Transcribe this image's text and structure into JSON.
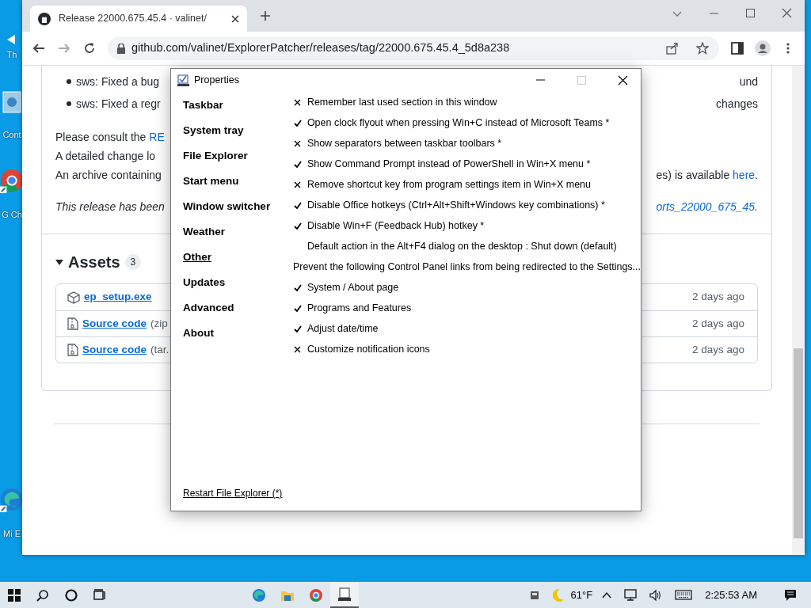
{
  "desktop": {
    "icons": [
      {
        "kind": "arrow",
        "label": "Th"
      },
      {
        "kind": "panel",
        "label": "Cont"
      },
      {
        "kind": "chrome",
        "label": "G Ch"
      },
      {
        "kind": "edge",
        "label": "Mi E"
      }
    ]
  },
  "browser": {
    "tab": {
      "title": "Release 22000.675.45.4 · valinet/"
    },
    "address": "github.com/valinet/ExplorerPatcher/releases/tag/22000.675.45.4_5d8a238",
    "page": {
      "bullets": [
        {
          "left": "sws: Fixed a bug",
          "right": "und"
        },
        {
          "left": "sws: Fixed a regr",
          "right": "changes"
        }
      ],
      "lines": [
        {
          "italic": false,
          "left": [
            {
              "kind": "text",
              "text": "Please consult the "
            },
            {
              "kind": "link",
              "text": "RE"
            }
          ]
        },
        {
          "italic": false,
          "left": [
            {
              "kind": "text",
              "text": "A detailed change lo"
            }
          ]
        },
        {
          "italic": false,
          "left": [
            {
              "kind": "text",
              "text": "An archive containing"
            }
          ],
          "right": [
            {
              "kind": "text",
              "text": "es) is available "
            },
            {
              "kind": "link",
              "text": "here"
            },
            {
              "kind": "text",
              "text": "."
            }
          ]
        },
        {
          "italic": true,
          "left": [
            {
              "kind": "text",
              "text": "This release has been"
            }
          ],
          "right": [
            {
              "kind": "link",
              "text": "orts_22000_675_45"
            },
            {
              "kind": "text",
              "text": "."
            }
          ]
        }
      ],
      "assets": {
        "title": "Assets",
        "count": "3",
        "files": [
          {
            "kind": "package",
            "name": "ep_setup.exe",
            "age": "2 days ago"
          },
          {
            "kind": "archive",
            "name": "Source code",
            "ext": "(zip",
            "age": "2 days ago"
          },
          {
            "kind": "archive",
            "name": "Source code",
            "ext": "(tar.",
            "age": "2 days ago"
          }
        ]
      }
    }
  },
  "dialog": {
    "title": "Properties",
    "nav": [
      {
        "label": "Taskbar",
        "selected": false
      },
      {
        "label": "System tray",
        "selected": false
      },
      {
        "label": "File Explorer",
        "selected": false
      },
      {
        "label": "Start menu",
        "selected": false
      },
      {
        "label": "Window switcher",
        "selected": false
      },
      {
        "label": "Weather",
        "selected": false
      },
      {
        "label": "Other",
        "selected": true
      },
      {
        "label": "Updates",
        "selected": false
      },
      {
        "label": "Advanced",
        "selected": false
      },
      {
        "label": "About",
        "selected": false
      }
    ],
    "settings": [
      {
        "kind": "toggle",
        "label": "Remember last used section in this window",
        "checked": false
      },
      {
        "kind": "toggle",
        "label": "Open clock flyout when pressing Win+C instead of Microsoft Teams *",
        "checked": true
      },
      {
        "kind": "toggle",
        "label": "Show separators between taskbar toolbars *",
        "checked": false
      },
      {
        "kind": "toggle",
        "label": "Show Command Prompt instead of PowerShell in Win+X menu *",
        "checked": true
      },
      {
        "kind": "toggle",
        "label": "Remove shortcut key from program settings item in Win+X menu",
        "checked": false
      },
      {
        "kind": "toggle",
        "label": "Disable Office hotkeys (Ctrl+Alt+Shift+Windows key combinations) *",
        "checked": true
      },
      {
        "kind": "toggle",
        "label": "Disable Win+F (Feedback Hub) hotkey *",
        "checked": true
      },
      {
        "kind": "choice",
        "label": "Default action in the Alt+F4 dialog on the desktop : Shut down (default)"
      },
      {
        "kind": "heading",
        "label": "Prevent the following Control Panel links from being redirected to the Settings..."
      },
      {
        "kind": "toggle",
        "label": "System / About page",
        "checked": true
      },
      {
        "kind": "toggle",
        "label": "Programs and Features",
        "checked": true
      },
      {
        "kind": "toggle",
        "label": "Adjust date/time",
        "checked": true
      },
      {
        "kind": "toggle",
        "label": "Customize notification icons",
        "checked": false
      }
    ],
    "footer_link": "Restart File Explorer (*)"
  },
  "taskbar": {
    "apps": [
      {
        "kind": "edge",
        "active": false
      },
      {
        "kind": "folder",
        "active": false
      },
      {
        "kind": "chrome",
        "active": false
      },
      {
        "kind": "app",
        "active": true
      }
    ],
    "temperature": "61°F",
    "time": "2:25:53 AM"
  }
}
